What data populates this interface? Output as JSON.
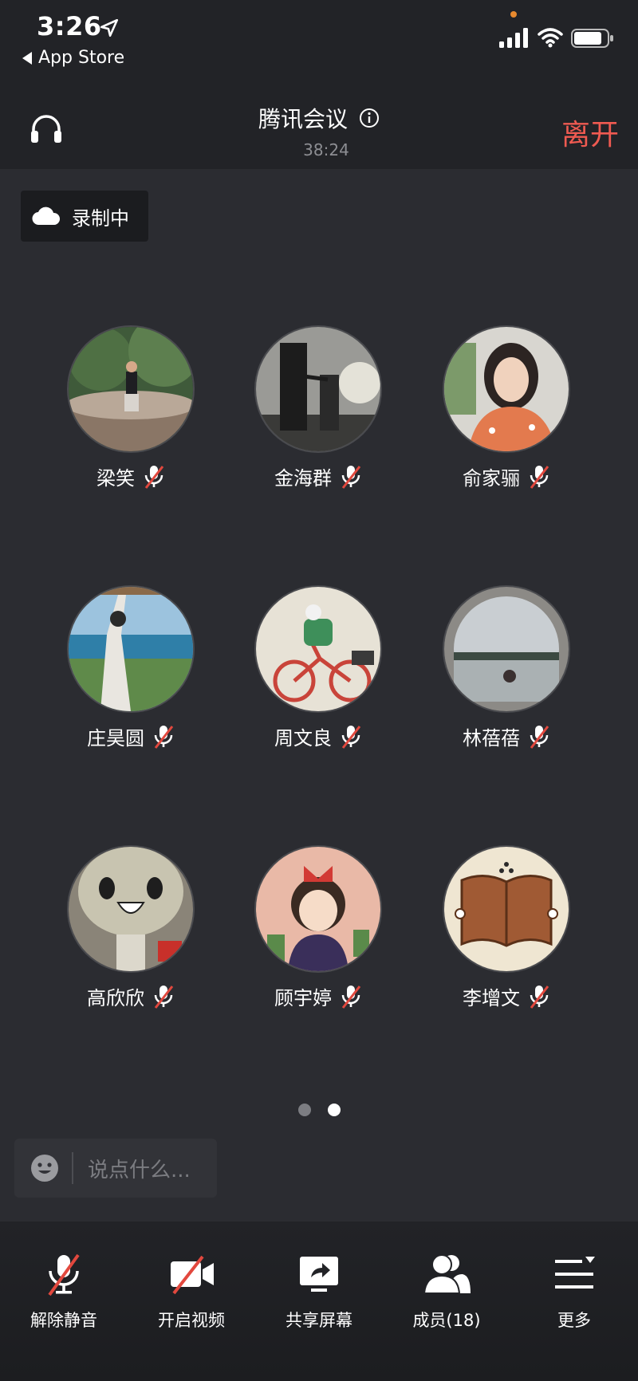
{
  "status_bar": {
    "time": "3:26",
    "back_label": "App Store"
  },
  "header": {
    "title": "腾讯会议",
    "timer": "38:24",
    "leave_label": "离开"
  },
  "recording": {
    "label": "录制中"
  },
  "participants": [
    {
      "name": "梁笑",
      "muted": true
    },
    {
      "name": "金海群",
      "muted": true
    },
    {
      "name": "俞家骊",
      "muted": true
    },
    {
      "name": "庄昊圆",
      "muted": true
    },
    {
      "name": "周文良",
      "muted": true
    },
    {
      "name": "林蓓蓓",
      "muted": true
    },
    {
      "name": "高欣欣",
      "muted": true
    },
    {
      "name": "顾宇婷",
      "muted": true
    },
    {
      "name": "李增文",
      "muted": true
    }
  ],
  "pagination": {
    "pages": 2,
    "current": 2
  },
  "chat": {
    "placeholder": "说点什么..."
  },
  "toolbar": {
    "unmute_label": "解除静音",
    "video_label": "开启视频",
    "share_label": "共享屏幕",
    "members_label": "成员(18)",
    "more_label": "更多"
  },
  "colors": {
    "leave": "#ef5a51",
    "background": "#2b2c31",
    "bar": "#222327"
  },
  "icons": [
    "location-arrow-icon",
    "signal-icon",
    "wifi-icon",
    "battery-icon",
    "headset-icon",
    "info-icon",
    "cloud-icon",
    "mic-muted-icon",
    "emoji-icon",
    "video-off-icon",
    "share-screen-icon",
    "members-icon",
    "more-icon"
  ]
}
